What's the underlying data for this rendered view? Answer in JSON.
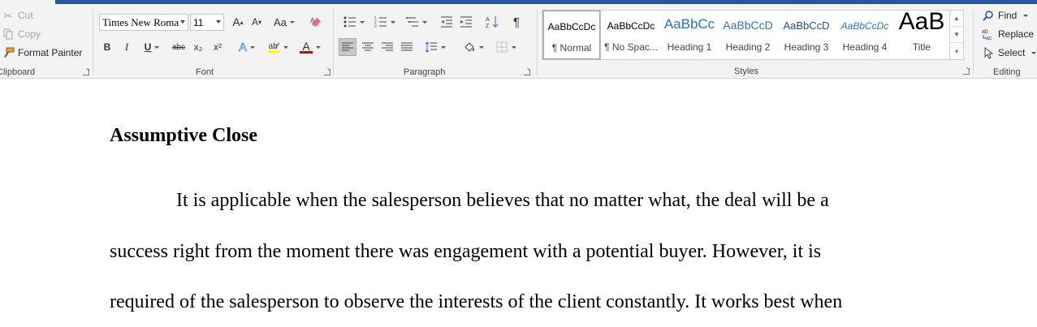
{
  "clipboard": {
    "cut_label": "Cut",
    "copy_label": "Copy",
    "format_painter_label": "Format Painter",
    "group_label": "Clipboard"
  },
  "font": {
    "font_name": "Times New Roma",
    "font_size": "11",
    "change_case_label": "Aa",
    "bold_label": "B",
    "italic_label": "I",
    "underline_label": "U",
    "strikethrough_label": "abc",
    "subscript_label": "x₂",
    "superscript_label": "x²",
    "grow_font_label": "A",
    "shrink_font_label": "A",
    "text_effects_label": "A",
    "font_color_label": "A",
    "highlight_color": "#ffff00",
    "font_color": "#e00000",
    "group_label": "Font"
  },
  "paragraph": {
    "group_label": "Paragraph",
    "show_marks_label": "¶"
  },
  "styles": {
    "group_label": "Styles",
    "items": [
      {
        "sample": "AaBbCcDc",
        "name": "¶ Normal"
      },
      {
        "sample": "AaBbCcDc",
        "name": "¶ No Spac..."
      },
      {
        "sample": "AaBbCc",
        "name": "Heading 1"
      },
      {
        "sample": "AaBbCcD",
        "name": "Heading 2"
      },
      {
        "sample": "AaBbCcD",
        "name": "Heading 3"
      },
      {
        "sample": "AaBbCcDc",
        "name": "Heading 4"
      },
      {
        "sample": "AaB",
        "name": "Title"
      }
    ]
  },
  "editing": {
    "find_label": "Find",
    "replace_label": "Replace",
    "select_label": "Select",
    "group_label": "Editing"
  },
  "document": {
    "heading": "Assumptive Close",
    "lines": [
      "It is applicable when the salesperson believes that no matter what, the deal will be a",
      "success right from the moment there was engagement with a potential buyer. However, it is",
      "required of the salesperson to observe the interests of the client constantly. It works best when"
    ]
  }
}
